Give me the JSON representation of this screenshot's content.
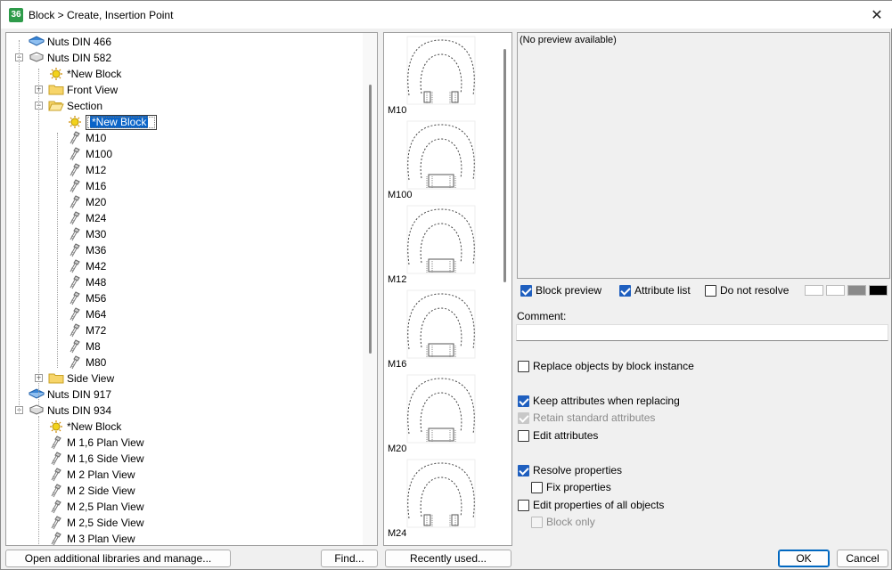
{
  "window": {
    "title": "Block > Create, Insertion Point",
    "close": "✕",
    "app_icon": "36"
  },
  "tree": [
    {
      "label": "Nuts DIN 466",
      "icon": "book-icon",
      "level": 0,
      "expander": ""
    },
    {
      "label": "Nuts DIN 582",
      "icon": "open-book-icon",
      "level": 0,
      "expander": "−"
    },
    {
      "label": "*New Block",
      "icon": "new-block-icon",
      "level": 1,
      "expander": ""
    },
    {
      "label": "Front View",
      "icon": "folder-icon",
      "level": 1,
      "expander": "+"
    },
    {
      "label": "Section",
      "icon": "open-folder-icon",
      "level": 1,
      "expander": "−"
    },
    {
      "label": "*New Block",
      "icon": "new-block-icon",
      "level": 2,
      "expander": "",
      "selected": true
    },
    {
      "label": "M10",
      "icon": "bolt-icon",
      "level": 2,
      "expander": ""
    },
    {
      "label": "M100",
      "icon": "bolt-icon",
      "level": 2,
      "expander": ""
    },
    {
      "label": "M12",
      "icon": "bolt-icon",
      "level": 2,
      "expander": ""
    },
    {
      "label": "M16",
      "icon": "bolt-icon",
      "level": 2,
      "expander": ""
    },
    {
      "label": "M20",
      "icon": "bolt-icon",
      "level": 2,
      "expander": ""
    },
    {
      "label": "M24",
      "icon": "bolt-icon",
      "level": 2,
      "expander": ""
    },
    {
      "label": "M30",
      "icon": "bolt-icon",
      "level": 2,
      "expander": ""
    },
    {
      "label": "M36",
      "icon": "bolt-icon",
      "level": 2,
      "expander": ""
    },
    {
      "label": "M42",
      "icon": "bolt-icon",
      "level": 2,
      "expander": ""
    },
    {
      "label": "M48",
      "icon": "bolt-icon",
      "level": 2,
      "expander": ""
    },
    {
      "label": "M56",
      "icon": "bolt-icon",
      "level": 2,
      "expander": ""
    },
    {
      "label": "M64",
      "icon": "bolt-icon",
      "level": 2,
      "expander": ""
    },
    {
      "label": "M72",
      "icon": "bolt-icon",
      "level": 2,
      "expander": ""
    },
    {
      "label": "M8",
      "icon": "bolt-icon",
      "level": 2,
      "expander": ""
    },
    {
      "label": "M80",
      "icon": "bolt-icon",
      "level": 2,
      "expander": ""
    },
    {
      "label": "Side View",
      "icon": "folder-icon",
      "level": 1,
      "expander": "+"
    },
    {
      "label": "Nuts DIN 917",
      "icon": "book-icon",
      "level": 0,
      "expander": ""
    },
    {
      "label": "Nuts DIN 934",
      "icon": "open-book-icon",
      "level": 0,
      "expander": "−"
    },
    {
      "label": "*New Block",
      "icon": "new-block-icon",
      "level": 1,
      "expander": ""
    },
    {
      "label": "M  1,6 Plan View",
      "icon": "bolt-icon",
      "level": 1,
      "expander": ""
    },
    {
      "label": "M  1,6 Side View",
      "icon": "bolt-icon",
      "level": 1,
      "expander": ""
    },
    {
      "label": "M  2 Plan View",
      "icon": "bolt-icon",
      "level": 1,
      "expander": ""
    },
    {
      "label": "M  2 Side View",
      "icon": "bolt-icon",
      "level": 1,
      "expander": ""
    },
    {
      "label": "M  2,5 Plan View",
      "icon": "bolt-icon",
      "level": 1,
      "expander": ""
    },
    {
      "label": "M  2,5 Side View",
      "icon": "bolt-icon",
      "level": 1,
      "expander": ""
    },
    {
      "label": "M  3 Plan View",
      "icon": "bolt-icon",
      "level": 1,
      "expander": ""
    }
  ],
  "thumbnails": [
    "M10",
    "M100",
    "M12",
    "M16",
    "M20",
    "M24"
  ],
  "preview": {
    "text": "(No preview available)"
  },
  "options": {
    "block_preview": {
      "label": "Block preview",
      "checked": true
    },
    "attribute_list": {
      "label": "Attribute list",
      "checked": true
    },
    "do_not_resolve": {
      "label": "Do not resolve",
      "checked": false
    },
    "comment_label": "Comment:",
    "comment_value": "",
    "replace_objects": {
      "label": "Replace objects by block instance",
      "checked": false
    },
    "keep_attributes": {
      "label": "Keep attributes when replacing",
      "checked": true
    },
    "retain_standard": {
      "label": "Retain standard attributes",
      "checked": true,
      "disabled": true
    },
    "edit_attributes": {
      "label": "Edit attributes",
      "checked": false
    },
    "resolve_properties": {
      "label": "Resolve properties",
      "checked": true
    },
    "fix_properties": {
      "label": "Fix properties",
      "checked": false
    },
    "edit_props_all": {
      "label": "Edit properties of all objects",
      "checked": false
    },
    "block_only": {
      "label": "Block only",
      "checked": false,
      "disabled": true
    }
  },
  "swatch_colors": [
    "#ffffff",
    "#ffffff",
    "#8a8a8a",
    "#000000"
  ],
  "buttons": {
    "open_libraries": "Open additional libraries and manage...",
    "find": "Find...",
    "recently_used": "Recently used...",
    "ok": "OK",
    "cancel": "Cancel"
  }
}
